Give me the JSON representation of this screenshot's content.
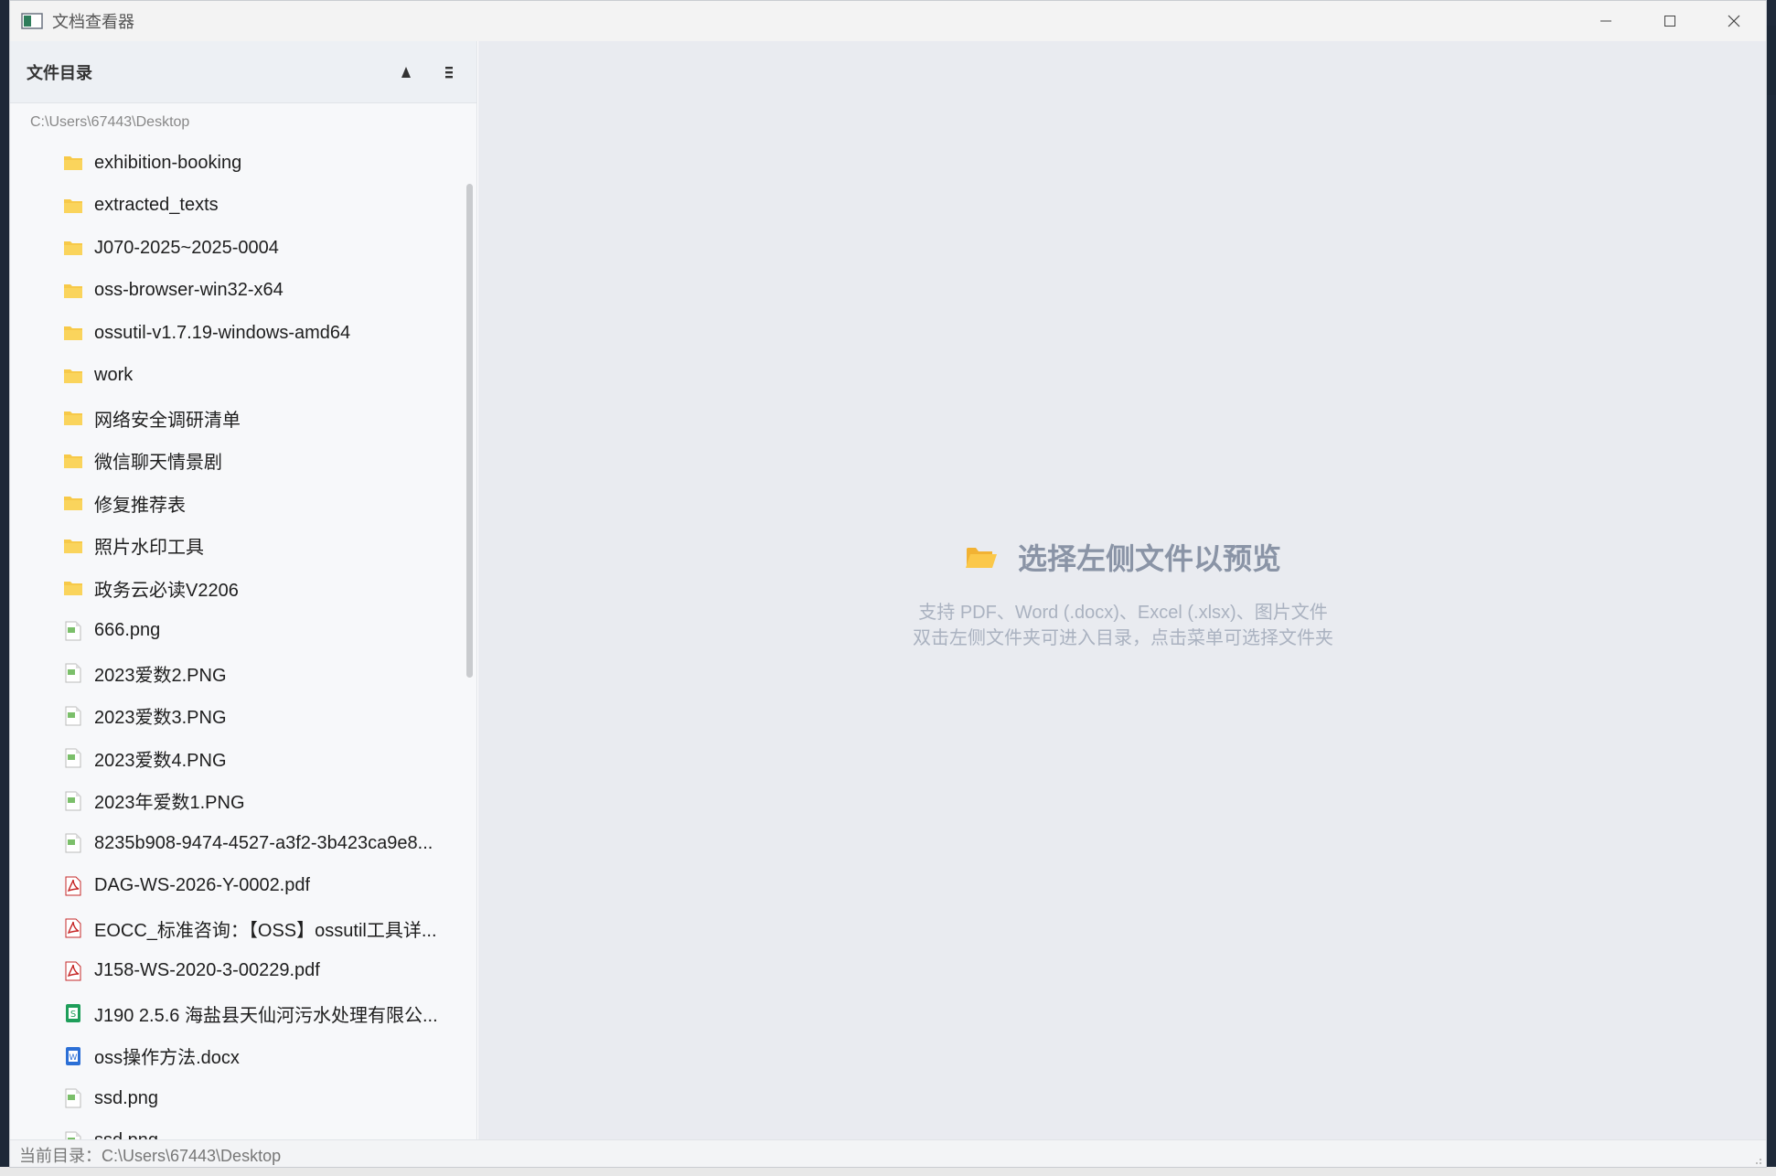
{
  "window": {
    "title": "文档查看器"
  },
  "sidebar": {
    "title": "文件目录",
    "path": "C:\\Users\\67443\\Desktop",
    "files": [
      {
        "name": "exhibition-booking",
        "type": "folder"
      },
      {
        "name": "extracted_texts",
        "type": "folder"
      },
      {
        "name": "J070-2025~2025-0004",
        "type": "folder"
      },
      {
        "name": "oss-browser-win32-x64",
        "type": "folder"
      },
      {
        "name": "ossutil-v1.7.19-windows-amd64",
        "type": "folder"
      },
      {
        "name": "work",
        "type": "folder"
      },
      {
        "name": "网络安全调研清单",
        "type": "folder"
      },
      {
        "name": "微信聊天情景剧",
        "type": "folder"
      },
      {
        "name": "修复推荐表",
        "type": "folder"
      },
      {
        "name": "照片水印工具",
        "type": "folder"
      },
      {
        "name": "政务云必读V2206",
        "type": "folder"
      },
      {
        "name": "666.png",
        "type": "image"
      },
      {
        "name": "2023爱数2.PNG",
        "type": "image"
      },
      {
        "name": "2023爱数3.PNG",
        "type": "image"
      },
      {
        "name": "2023爱数4.PNG",
        "type": "image"
      },
      {
        "name": "2023年爱数1.PNG",
        "type": "image"
      },
      {
        "name": "8235b908-9474-4527-a3f2-3b423ca9e8...",
        "type": "image"
      },
      {
        "name": "DAG-WS-2026-Y-0002.pdf",
        "type": "pdf"
      },
      {
        "name": "EOCC_标准咨询：【OSS】ossutil工具详...",
        "type": "pdf"
      },
      {
        "name": "J158-WS-2020-3-00229.pdf",
        "type": "pdf"
      },
      {
        "name": "J190 2.5.6 海盐县天仙河污水处理有限公...",
        "type": "excel"
      },
      {
        "name": "oss操作方法.docx",
        "type": "word"
      },
      {
        "name": "ssd.png",
        "type": "image"
      },
      {
        "name": "ssd.png",
        "type": "image"
      }
    ]
  },
  "preview": {
    "title": "选择左侧文件以预览",
    "hint_line1": "支持 PDF、Word (.docx)、Excel (.xlsx)、图片文件",
    "hint_line2": "双击左侧文件夹可进入目录，点击菜单可选择文件夹"
  },
  "statusbar": {
    "text": "当前目录：C:\\Users\\67443\\Desktop"
  },
  "colors": {
    "folder": "#f7c948",
    "pdf": "#c62828",
    "excel": "#1e9e5a",
    "word": "#2b6fd6",
    "image_green": "#7bbf6a",
    "preview_bg": "#e9ebf0",
    "preview_title": "#8a94a6"
  }
}
